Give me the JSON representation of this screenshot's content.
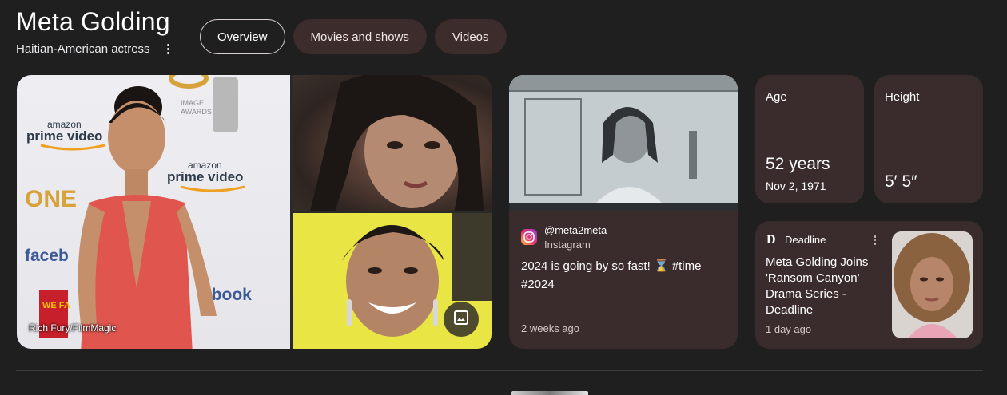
{
  "entity": {
    "name": "Meta Golding",
    "description": "Haitian-American actress"
  },
  "tabs": [
    {
      "label": "Overview",
      "active": true
    },
    {
      "label": "Movies and shows",
      "active": false
    },
    {
      "label": "Videos",
      "active": false
    }
  ],
  "images": {
    "credit": "Rich Fury/FilmMagic",
    "gallery_icon": "image-gallery-icon",
    "main_backdrop_text": [
      "amazon",
      "prime video",
      "ONE",
      "IMAGE",
      "AWARDS",
      "faceb",
      "ebook",
      "WE FA"
    ]
  },
  "instagram": {
    "icon": "instagram-icon",
    "handle": "@meta2meta",
    "source": "Instagram",
    "text": "2024 is going by so fast! ⌛ #time #2024",
    "time": "2 weeks ago"
  },
  "age": {
    "label": "Age",
    "value": "52 years",
    "sub": "Nov 2, 1971"
  },
  "height": {
    "label": "Height",
    "value": "5′ 5″"
  },
  "news": {
    "logo": "D",
    "source": "Deadline",
    "headline": "Meta Golding Joins 'Ransom Canyon' Drama Series - Deadline",
    "time": "1 day ago"
  },
  "colors": {
    "background": "#1f1f1f",
    "card": "#3a2c2c",
    "tab": "#3c2c2c",
    "text": "#ffffff",
    "muted": "#d5c7c7",
    "gallery_button": "#4e4a2e"
  }
}
